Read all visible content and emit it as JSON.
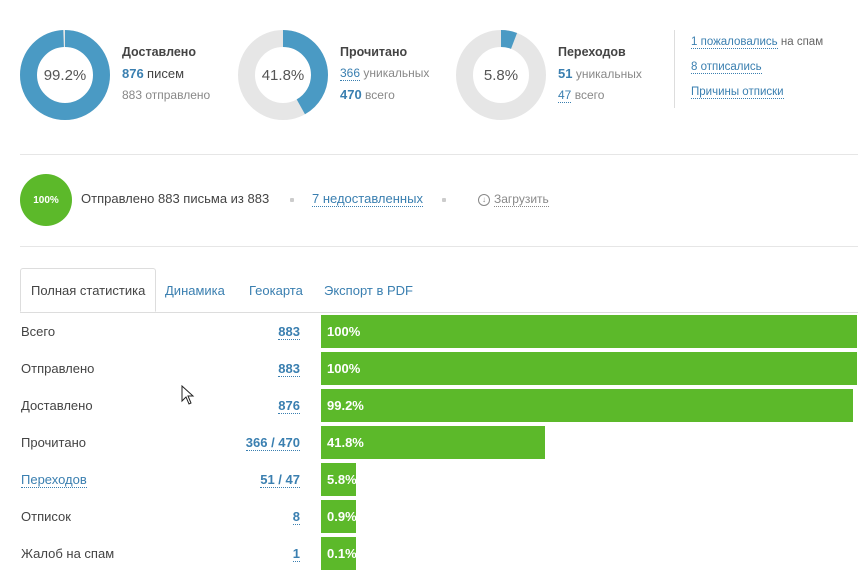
{
  "summary": {
    "delivered": {
      "percent_label": "99.2%",
      "fraction": 0.992,
      "title": "Доставлено",
      "count": "876",
      "count_unit": "писем",
      "sent_text": "883 отправлено"
    },
    "read": {
      "percent_label": "41.8%",
      "fraction": 0.418,
      "title": "Прочитано",
      "unique_count": "366",
      "unique_unit": "уникальных",
      "total_count": "470",
      "total_unit": "всего"
    },
    "clicks": {
      "percent_label": "5.8%",
      "fraction": 0.058,
      "title": "Переходов",
      "unique_count": "51",
      "unique_unit": "уникальных",
      "total_count": "47",
      "total_unit": "всего"
    },
    "links": {
      "spam_link": "1 пожаловались",
      "spam_suffix": "на спам",
      "unsubscribed_link": "8 отписались",
      "reasons_link": "Причины отписки"
    }
  },
  "sending": {
    "badge": "100%",
    "status_text": "Отправлено 883 письма из 883",
    "undelivered_link": "7 недоставленных",
    "download_label": "Загрузить"
  },
  "tabs": [
    {
      "label": "Полная статистика",
      "active": true
    },
    {
      "label": "Динамика",
      "active": false
    },
    {
      "label": "Геокарта",
      "active": false
    },
    {
      "label": "Экспорт в PDF",
      "active": false
    }
  ],
  "stats_table": {
    "rows": [
      {
        "label": "Всего",
        "value": "883",
        "percent_label": "100%",
        "fraction": 1.0,
        "label_is_link": false
      },
      {
        "label": "Отправлено",
        "value": "883",
        "percent_label": "100%",
        "fraction": 1.0,
        "label_is_link": false
      },
      {
        "label": "Доставлено",
        "value": "876",
        "percent_label": "99.2%",
        "fraction": 0.992,
        "label_is_link": false
      },
      {
        "label": "Прочитано",
        "value": "366 / 470",
        "percent_label": "41.8%",
        "fraction": 0.418,
        "label_is_link": false
      },
      {
        "label": "Переходов",
        "value": "51 / 47",
        "percent_label": "5.8%",
        "fraction": 0.058,
        "label_is_link": true
      },
      {
        "label": "Отписок",
        "value": "8",
        "percent_label": "0.9%",
        "fraction": 0.009,
        "label_is_link": false
      },
      {
        "label": "Жалоб на спам",
        "value": "1",
        "percent_label": "0.1%",
        "fraction": 0.001,
        "label_is_link": false
      }
    ]
  },
  "colors": {
    "accent_green": "#5cb92a",
    "donut_blue": "#4a9ac4",
    "donut_track": "#e6e6e6",
    "link_blue": "#3a7fb0"
  }
}
